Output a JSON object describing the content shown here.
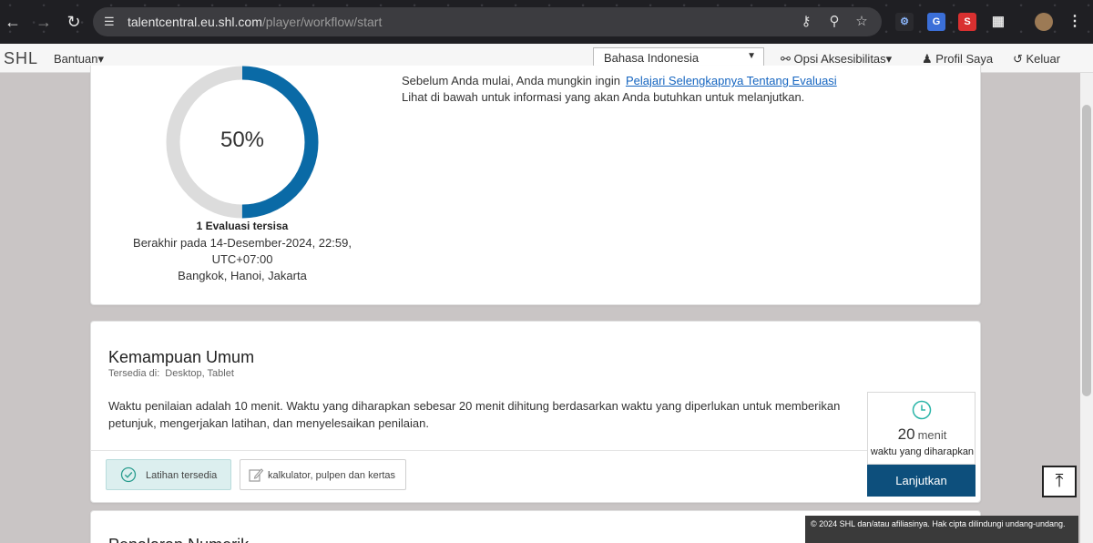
{
  "browser": {
    "url_host": "talentcentral.eu.shl.com",
    "url_path": "/player/workflow/start"
  },
  "header": {
    "logo": "SHL",
    "help_label": "Bantuan",
    "language": "Bahasa Indonesia",
    "accessibility_label": "Opsi Aksesibilitas",
    "profile_label": "Profil Saya",
    "logout_label": "Keluar"
  },
  "progress": {
    "percent_label": "50%",
    "fraction": 0.5,
    "color": "#0a6aa6",
    "track_color": "#dcdcdc",
    "remaining_label": "1 Evaluasi tersisa",
    "end_line_1": "Berakhir pada 14-Desember-2024, 22:59,",
    "end_line_2": "UTC+07:00",
    "end_line_3": "Bangkok, Hanoi, Jakarta"
  },
  "intro": {
    "before_text": "Sebelum Anda mulai, Anda mungkin ingin",
    "learn_more_link": "Pelajari Selengkapnya Tentang Evaluasi",
    "info_text": "Lihat di bawah untuk informasi yang akan Anda butuhkan untuk melanjutkan."
  },
  "assessment": {
    "title": "Kemampuan Umum",
    "available_label": "Tersedia di:",
    "available_value": "Desktop, Tablet",
    "description_line_1": "Waktu penilaian adalah 10 menit. Waktu yang diharapkan sebesar 20 menit dihitung berdasarkan waktu yang diperlukan untuk memberikan",
    "description_line_2": "petunjuk, mengerjakan latihan, dan menyelesaikan penilaian.",
    "practice_label": "Latihan tersedia",
    "materials_label": "kalkulator, pulpen dan kertas",
    "minutes_value": "20",
    "minutes_unit": "menit",
    "expected_label": "waktu yang diharapkan",
    "continue_label": "Lanjutkan"
  },
  "next_assessment": {
    "title": "Penalaran Numerik"
  },
  "footer": {
    "copyright": "© 2024 SHL dan/atau afiliasinya. Hak cipta dilindungi undang-undang."
  },
  "icons": {
    "back": "arrow-left-icon",
    "forward": "arrow-right-icon",
    "reload": "reload-icon",
    "clock": "clock-icon",
    "check": "check-circle-icon",
    "edit": "edit-icon",
    "scroll_top": "scroll-top-icon"
  }
}
